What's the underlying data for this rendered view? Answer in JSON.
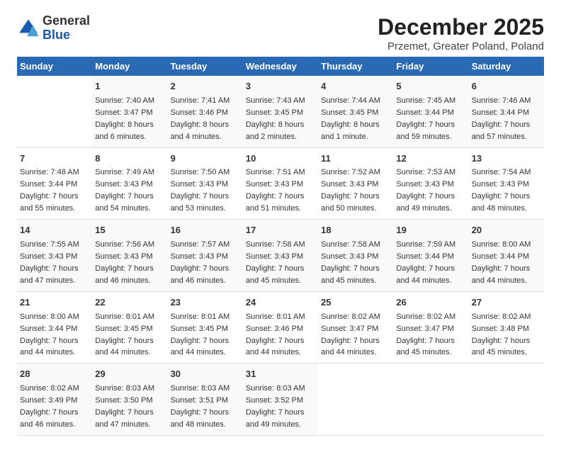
{
  "header": {
    "logo_general": "General",
    "logo_blue": "Blue",
    "title": "December 2025",
    "subtitle": "Przemet, Greater Poland, Poland"
  },
  "weekdays": [
    "Sunday",
    "Monday",
    "Tuesday",
    "Wednesday",
    "Thursday",
    "Friday",
    "Saturday"
  ],
  "weeks": [
    [
      {
        "day": "",
        "info": ""
      },
      {
        "day": "1",
        "info": "Sunrise: 7:40 AM\nSunset: 3:47 PM\nDaylight: 8 hours\nand 6 minutes."
      },
      {
        "day": "2",
        "info": "Sunrise: 7:41 AM\nSunset: 3:46 PM\nDaylight: 8 hours\nand 4 minutes."
      },
      {
        "day": "3",
        "info": "Sunrise: 7:43 AM\nSunset: 3:45 PM\nDaylight: 8 hours\nand 2 minutes."
      },
      {
        "day": "4",
        "info": "Sunrise: 7:44 AM\nSunset: 3:45 PM\nDaylight: 8 hours\nand 1 minute."
      },
      {
        "day": "5",
        "info": "Sunrise: 7:45 AM\nSunset: 3:44 PM\nDaylight: 7 hours\nand 59 minutes."
      },
      {
        "day": "6",
        "info": "Sunrise: 7:46 AM\nSunset: 3:44 PM\nDaylight: 7 hours\nand 57 minutes."
      }
    ],
    [
      {
        "day": "7",
        "info": "Sunrise: 7:48 AM\nSunset: 3:44 PM\nDaylight: 7 hours\nand 55 minutes."
      },
      {
        "day": "8",
        "info": "Sunrise: 7:49 AM\nSunset: 3:43 PM\nDaylight: 7 hours\nand 54 minutes."
      },
      {
        "day": "9",
        "info": "Sunrise: 7:50 AM\nSunset: 3:43 PM\nDaylight: 7 hours\nand 53 minutes."
      },
      {
        "day": "10",
        "info": "Sunrise: 7:51 AM\nSunset: 3:43 PM\nDaylight: 7 hours\nand 51 minutes."
      },
      {
        "day": "11",
        "info": "Sunrise: 7:52 AM\nSunset: 3:43 PM\nDaylight: 7 hours\nand 50 minutes."
      },
      {
        "day": "12",
        "info": "Sunrise: 7:53 AM\nSunset: 3:43 PM\nDaylight: 7 hours\nand 49 minutes."
      },
      {
        "day": "13",
        "info": "Sunrise: 7:54 AM\nSunset: 3:43 PM\nDaylight: 7 hours\nand 48 minutes."
      }
    ],
    [
      {
        "day": "14",
        "info": "Sunrise: 7:55 AM\nSunset: 3:43 PM\nDaylight: 7 hours\nand 47 minutes."
      },
      {
        "day": "15",
        "info": "Sunrise: 7:56 AM\nSunset: 3:43 PM\nDaylight: 7 hours\nand 46 minutes."
      },
      {
        "day": "16",
        "info": "Sunrise: 7:57 AM\nSunset: 3:43 PM\nDaylight: 7 hours\nand 46 minutes."
      },
      {
        "day": "17",
        "info": "Sunrise: 7:58 AM\nSunset: 3:43 PM\nDaylight: 7 hours\nand 45 minutes."
      },
      {
        "day": "18",
        "info": "Sunrise: 7:58 AM\nSunset: 3:43 PM\nDaylight: 7 hours\nand 45 minutes."
      },
      {
        "day": "19",
        "info": "Sunrise: 7:59 AM\nSunset: 3:44 PM\nDaylight: 7 hours\nand 44 minutes."
      },
      {
        "day": "20",
        "info": "Sunrise: 8:00 AM\nSunset: 3:44 PM\nDaylight: 7 hours\nand 44 minutes."
      }
    ],
    [
      {
        "day": "21",
        "info": "Sunrise: 8:00 AM\nSunset: 3:44 PM\nDaylight: 7 hours\nand 44 minutes."
      },
      {
        "day": "22",
        "info": "Sunrise: 8:01 AM\nSunset: 3:45 PM\nDaylight: 7 hours\nand 44 minutes."
      },
      {
        "day": "23",
        "info": "Sunrise: 8:01 AM\nSunset: 3:45 PM\nDaylight: 7 hours\nand 44 minutes."
      },
      {
        "day": "24",
        "info": "Sunrise: 8:01 AM\nSunset: 3:46 PM\nDaylight: 7 hours\nand 44 minutes."
      },
      {
        "day": "25",
        "info": "Sunrise: 8:02 AM\nSunset: 3:47 PM\nDaylight: 7 hours\nand 44 minutes."
      },
      {
        "day": "26",
        "info": "Sunrise: 8:02 AM\nSunset: 3:47 PM\nDaylight: 7 hours\nand 45 minutes."
      },
      {
        "day": "27",
        "info": "Sunrise: 8:02 AM\nSunset: 3:48 PM\nDaylight: 7 hours\nand 45 minutes."
      }
    ],
    [
      {
        "day": "28",
        "info": "Sunrise: 8:02 AM\nSunset: 3:49 PM\nDaylight: 7 hours\nand 46 minutes."
      },
      {
        "day": "29",
        "info": "Sunrise: 8:03 AM\nSunset: 3:50 PM\nDaylight: 7 hours\nand 47 minutes."
      },
      {
        "day": "30",
        "info": "Sunrise: 8:03 AM\nSunset: 3:51 PM\nDaylight: 7 hours\nand 48 minutes."
      },
      {
        "day": "31",
        "info": "Sunrise: 8:03 AM\nSunset: 3:52 PM\nDaylight: 7 hours\nand 49 minutes."
      },
      {
        "day": "",
        "info": ""
      },
      {
        "day": "",
        "info": ""
      },
      {
        "day": "",
        "info": ""
      }
    ]
  ]
}
